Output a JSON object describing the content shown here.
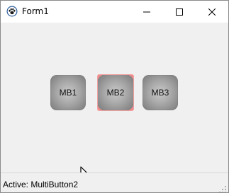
{
  "window": {
    "title": "Form1"
  },
  "buttons": [
    {
      "label": "MB1"
    },
    {
      "label": "MB2"
    },
    {
      "label": "MB3"
    }
  ],
  "active_index": 1,
  "status": {
    "text": "Active: MultiButton2"
  },
  "icons": {
    "app": "paw-icon",
    "minimize": "minimize-icon",
    "maximize": "maximize-icon",
    "close": "close-icon",
    "grip": "resize-grip-icon",
    "cursor": "mouse-pointer-icon"
  },
  "colors": {
    "active_indicator": "#f08c8c",
    "button_center": "#c9c9c9",
    "button_edge": "#7c7c7c"
  }
}
